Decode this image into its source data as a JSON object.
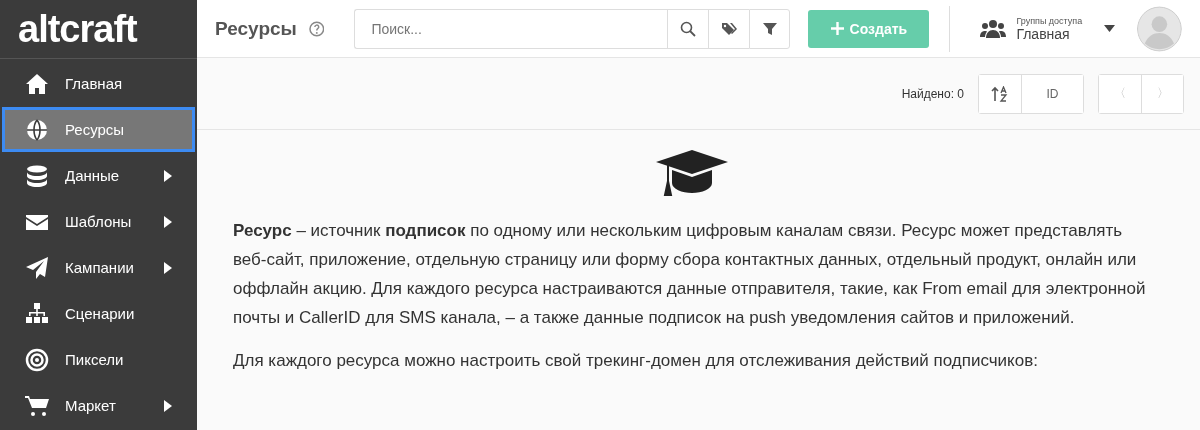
{
  "logo": "altcraft",
  "sidebar": {
    "items": [
      {
        "label": "Главная",
        "selected": false,
        "has_submenu": false
      },
      {
        "label": "Ресурсы",
        "selected": true,
        "has_submenu": false
      },
      {
        "label": "Данные",
        "selected": false,
        "has_submenu": true
      },
      {
        "label": "Шаблоны",
        "selected": false,
        "has_submenu": true
      },
      {
        "label": "Кампании",
        "selected": false,
        "has_submenu": true
      },
      {
        "label": "Сценарии",
        "selected": false,
        "has_submenu": false
      },
      {
        "label": "Пиксели",
        "selected": false,
        "has_submenu": false
      },
      {
        "label": "Маркет",
        "selected": false,
        "has_submenu": true
      }
    ]
  },
  "header": {
    "title": "Ресурсы",
    "search": {
      "placeholder": "Поиск..."
    },
    "create_button": "Создать",
    "access_group": {
      "label": "Группы доступа",
      "value": "Главная"
    }
  },
  "toolbar": {
    "found": "Найдено: 0",
    "sort_field": "ID",
    "prev": "〈",
    "next": "〉"
  },
  "content": {
    "paragraphs": [
      "**Ресурс** – источник **подписок** по одному или нескольким цифровым каналам связи. Ресурс может представлять веб-сайт, приложение, отдельную страницу или форму сбора контактных данных, отдельный продукт, онлайн или оффлайн акцию. Для каждого ресурса настраиваются данные отправителя, такие, как From email для электронной почты и CallerID для SMS канала, – а также данные подписок на push уведомления сайтов и приложений.",
      "Для каждого ресурса можно настроить свой трекинг-домен для отслеживания действий подписчиков:"
    ]
  }
}
